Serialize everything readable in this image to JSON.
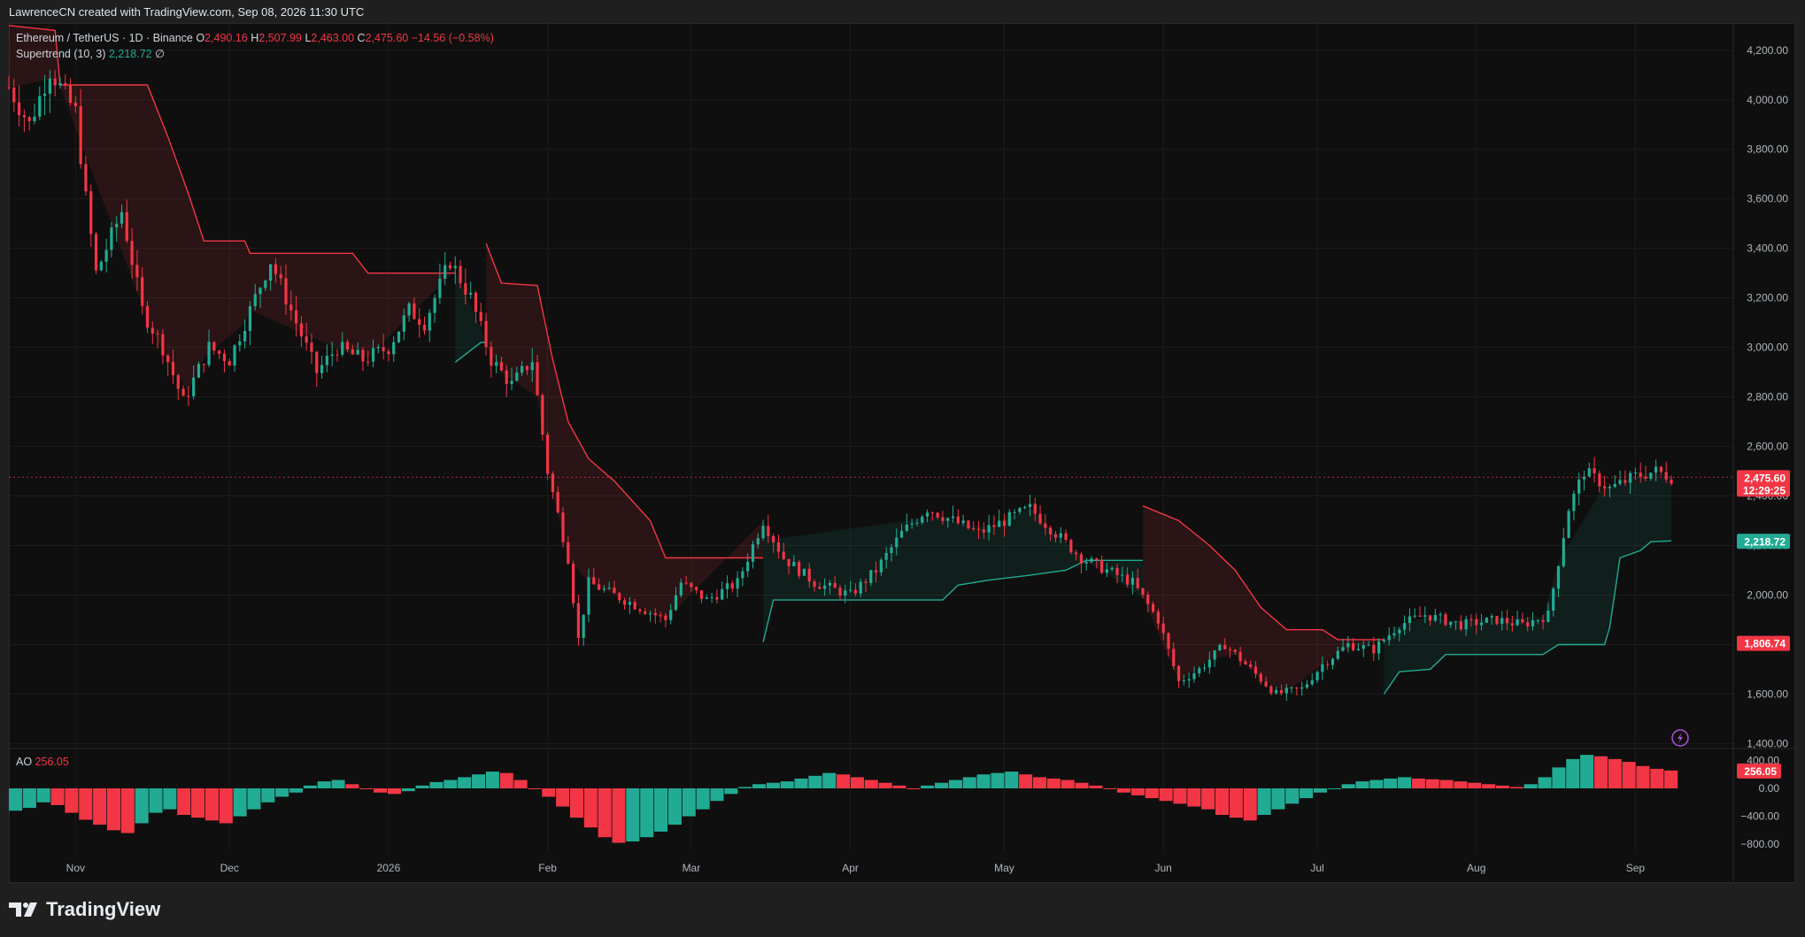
{
  "header": {
    "title": "LawrenceCN created with TradingView.com, Sep 08, 2026 11:30 UTC"
  },
  "legend": {
    "symbol": "Ethereum / TetherUS · 1D · Binance",
    "o_label": "O",
    "o_value": "2,490.16",
    "h_label": "H",
    "h_value": "2,507.99",
    "l_label": "L",
    "l_value": "2,463.00",
    "c_label": "C",
    "c_value": "2,475.60",
    "change": "−14.56 (−0.58%)",
    "indicator": "Supertrend (10, 3)",
    "indicator_value": "2,218.72",
    "indicator_extra": "∅"
  },
  "ao": {
    "label": "AO",
    "value": "256.05"
  },
  "footer": {
    "brand": "TradingView"
  },
  "price_tags": {
    "last": "2,475.60",
    "countdown": "12:29:25",
    "supertrend": "2,218.72",
    "upper": "1,806.74",
    "ao_value": "256.05"
  },
  "colors": {
    "up": "#22ab94",
    "down": "#f23645",
    "bg": "#0f0f0f"
  },
  "chart_data": [
    {
      "type": "candlestick",
      "title": "Ethereum / TetherUS · 1D · Binance",
      "x_ticks": [
        "Nov",
        "Dec",
        "2026",
        "Feb",
        "Mar",
        "Apr",
        "May",
        "Jun",
        "Jul",
        "Aug",
        "Sep"
      ],
      "y_ticks": [
        "4,200.00",
        "4,000.00",
        "3,800.00",
        "3,600.00",
        "3,400.00",
        "3,200.00",
        "3,000.00",
        "2,800.00",
        "2,600.00",
        "2,400.00",
        "2,200.00",
        "2,000.00",
        "1,800.00",
        "1,600.00",
        "1,400.00"
      ],
      "ylim": [
        1380,
        4260
      ],
      "close_path": [
        {
          "x": "Oct 19",
          "y": 4050
        },
        {
          "x": "Oct 23",
          "y": 3900
        },
        {
          "x": "Oct 27",
          "y": 4120
        },
        {
          "x": "Nov 01",
          "y": 3950
        },
        {
          "x": "Nov 03",
          "y": 3600
        },
        {
          "x": "Nov 05",
          "y": 3300
        },
        {
          "x": "Nov 10",
          "y": 3550
        },
        {
          "x": "Nov 14",
          "y": 3150
        },
        {
          "x": "Nov 18",
          "y": 3000
        },
        {
          "x": "Nov 22",
          "y": 2780
        },
        {
          "x": "Nov 27",
          "y": 3000
        },
        {
          "x": "Dec 01",
          "y": 2950
        },
        {
          "x": "Dec 05",
          "y": 3150
        },
        {
          "x": "Dec 09",
          "y": 3350
        },
        {
          "x": "Dec 14",
          "y": 3100
        },
        {
          "x": "Dec 18",
          "y": 2900
        },
        {
          "x": "Dec 22",
          "y": 3000
        },
        {
          "x": "Dec 27",
          "y": 2950
        },
        {
          "x": "Jan 01",
          "y": 3000
        },
        {
          "x": "Jan 05",
          "y": 3150
        },
        {
          "x": "Jan 08",
          "y": 3100
        },
        {
          "x": "Jan 13",
          "y": 3350
        },
        {
          "x": "Jan 17",
          "y": 3200
        },
        {
          "x": "Jan 21",
          "y": 2950
        },
        {
          "x": "Jan 25",
          "y": 2850
        },
        {
          "x": "Jan 29",
          "y": 2950
        },
        {
          "x": "Feb 01",
          "y": 2500
        },
        {
          "x": "Feb 05",
          "y": 2150
        },
        {
          "x": "Feb 07",
          "y": 1820
        },
        {
          "x": "Feb 09",
          "y": 2050
        },
        {
          "x": "Feb 14",
          "y": 2000
        },
        {
          "x": "Feb 19",
          "y": 1950
        },
        {
          "x": "Feb 24",
          "y": 1900
        },
        {
          "x": "Feb 27",
          "y": 2050
        },
        {
          "x": "Mar 04",
          "y": 1980
        },
        {
          "x": "Mar 10",
          "y": 2050
        },
        {
          "x": "Mar 15",
          "y": 2300
        },
        {
          "x": "Mar 19",
          "y": 2150
        },
        {
          "x": "Mar 25",
          "y": 2050
        },
        {
          "x": "Apr 01",
          "y": 2000
        },
        {
          "x": "Apr 06",
          "y": 2100
        },
        {
          "x": "Apr 11",
          "y": 2250
        },
        {
          "x": "Apr 16",
          "y": 2350
        },
        {
          "x": "Apr 21",
          "y": 2300
        },
        {
          "x": "Apr 26",
          "y": 2250
        },
        {
          "x": "May 01",
          "y": 2300
        },
        {
          "x": "May 06",
          "y": 2350
        },
        {
          "x": "May 11",
          "y": 2250
        },
        {
          "x": "May 16",
          "y": 2150
        },
        {
          "x": "May 21",
          "y": 2100
        },
        {
          "x": "May 26",
          "y": 2050
        },
        {
          "x": "May 31",
          "y": 1900
        },
        {
          "x": "Jun 04",
          "y": 1650
        },
        {
          "x": "Jun 08",
          "y": 1700
        },
        {
          "x": "Jun 13",
          "y": 1800
        },
        {
          "x": "Jun 18",
          "y": 1700
        },
        {
          "x": "Jun 23",
          "y": 1600
        },
        {
          "x": "Jun 28",
          "y": 1620
        },
        {
          "x": "Jul 02",
          "y": 1720
        },
        {
          "x": "Jul 07",
          "y": 1800
        },
        {
          "x": "Jul 12",
          "y": 1780
        },
        {
          "x": "Jul 17",
          "y": 1880
        },
        {
          "x": "Jul 22",
          "y": 1920
        },
        {
          "x": "Jul 29",
          "y": 1880
        },
        {
          "x": "Aug 05",
          "y": 1900
        },
        {
          "x": "Aug 10",
          "y": 1880
        },
        {
          "x": "Aug 15",
          "y": 1920
        },
        {
          "x": "Aug 19",
          "y": 2350
        },
        {
          "x": "Aug 22",
          "y": 2500
        },
        {
          "x": "Aug 27",
          "y": 2430
        },
        {
          "x": "Sep 01",
          "y": 2480
        },
        {
          "x": "Sep 05",
          "y": 2500
        },
        {
          "x": "Sep 08",
          "y": 2475.6
        }
      ],
      "supertrend_red": [
        {
          "x": "Oct 19",
          "y": 4300
        },
        {
          "x": "Oct 28",
          "y": 4280
        },
        {
          "x": "Oct 29",
          "y": 4060
        },
        {
          "x": "Nov 15",
          "y": 4060
        },
        {
          "x": "Nov 19",
          "y": 3850
        },
        {
          "x": "Nov 23",
          "y": 3620
        },
        {
          "x": "Nov 26",
          "y": 3430
        },
        {
          "x": "Dec 04",
          "y": 3430
        },
        {
          "x": "Dec 05",
          "y": 3380
        },
        {
          "x": "Dec 25",
          "y": 3380
        },
        {
          "x": "Dec 28",
          "y": 3300
        },
        {
          "x": "Jan 14",
          "y": 3300
        }
      ],
      "supertrend_red_2": [
        {
          "x": "Jan 20",
          "y": 3420
        },
        {
          "x": "Jan 23",
          "y": 3260
        },
        {
          "x": "Jan 30",
          "y": 3250
        },
        {
          "x": "Feb 02",
          "y": 2950
        },
        {
          "x": "Feb 05",
          "y": 2700
        },
        {
          "x": "Feb 09",
          "y": 2550
        },
        {
          "x": "Feb 14",
          "y": 2460
        },
        {
          "x": "Feb 21",
          "y": 2300
        },
        {
          "x": "Feb 24",
          "y": 2150
        },
        {
          "x": "Mar 15",
          "y": 2150
        }
      ],
      "supertrend_green": [
        {
          "x": "Jan 14",
          "y": 2940
        },
        {
          "x": "Jan 19",
          "y": 3020
        },
        {
          "x": "Jan 20",
          "y": 3020
        }
      ],
      "supertrend_green_2": [
        {
          "x": "Mar 15",
          "y": 1810
        },
        {
          "x": "Mar 17",
          "y": 1980
        },
        {
          "x": "Apr 19",
          "y": 1980
        },
        {
          "x": "Apr 22",
          "y": 2040
        },
        {
          "x": "Apr 28",
          "y": 2060
        },
        {
          "x": "May 06",
          "y": 2080
        },
        {
          "x": "May 13",
          "y": 2100
        },
        {
          "x": "May 17",
          "y": 2140
        },
        {
          "x": "May 28",
          "y": 2140
        }
      ],
      "supertrend_red_3": [
        {
          "x": "May 28",
          "y": 2360
        },
        {
          "x": "Jun 04",
          "y": 2300
        },
        {
          "x": "Jun 10",
          "y": 2200
        },
        {
          "x": "Jun 15",
          "y": 2100
        },
        {
          "x": "Jun 20",
          "y": 1950
        },
        {
          "x": "Jun 25",
          "y": 1860
        },
        {
          "x": "Jul 02",
          "y": 1860
        },
        {
          "x": "Jul 05",
          "y": 1820
        },
        {
          "x": "Jul 14",
          "y": 1820
        }
      ],
      "supertrend_green_3": [
        {
          "x": "Jul 14",
          "y": 1600
        },
        {
          "x": "Jul 17",
          "y": 1690
        },
        {
          "x": "Jul 23",
          "y": 1700
        },
        {
          "x": "Jul 26",
          "y": 1760
        },
        {
          "x": "Aug 14",
          "y": 1760
        },
        {
          "x": "Aug 17",
          "y": 1800
        },
        {
          "x": "Aug 26",
          "y": 1800
        },
        {
          "x": "Aug 27",
          "y": 1870
        },
        {
          "x": "Aug 29",
          "y": 2150
        },
        {
          "x": "Sep 02",
          "y": 2180
        },
        {
          "x": "Sep 04",
          "y": 2215
        },
        {
          "x": "Sep 08",
          "y": 2218.72
        }
      ]
    },
    {
      "type": "bar",
      "title": "AO",
      "y_ticks": [
        "400.00",
        "0.00",
        "−400.00",
        "−800.00"
      ],
      "ylim": [
        -900,
        520
      ],
      "values": [
        -320,
        -280,
        -200,
        -240,
        -350,
        -450,
        -520,
        -600,
        -640,
        -500,
        -350,
        -300,
        -380,
        -420,
        -460,
        -500,
        -400,
        -300,
        -200,
        -120,
        -60,
        40,
        100,
        120,
        60,
        0,
        -60,
        -80,
        -40,
        40,
        90,
        120,
        160,
        200,
        240,
        220,
        120,
        0,
        -120,
        -260,
        -420,
        -560,
        -700,
        -780,
        -760,
        -700,
        -620,
        -520,
        -400,
        -300,
        -180,
        -80,
        20,
        60,
        80,
        100,
        140,
        180,
        220,
        200,
        160,
        120,
        80,
        40,
        0,
        40,
        80,
        120,
        160,
        200,
        220,
        240,
        200,
        160,
        140,
        120,
        80,
        40,
        0,
        -60,
        -100,
        -140,
        -180,
        -220,
        -260,
        -300,
        -380,
        -420,
        -460,
        -380,
        -300,
        -220,
        -140,
        -60,
        0,
        60,
        100,
        120,
        140,
        160,
        140,
        130,
        120,
        100,
        80,
        60,
        40,
        20,
        60,
        160,
        300,
        420,
        480,
        460,
        420,
        380,
        320,
        280,
        256.05
      ]
    }
  ]
}
